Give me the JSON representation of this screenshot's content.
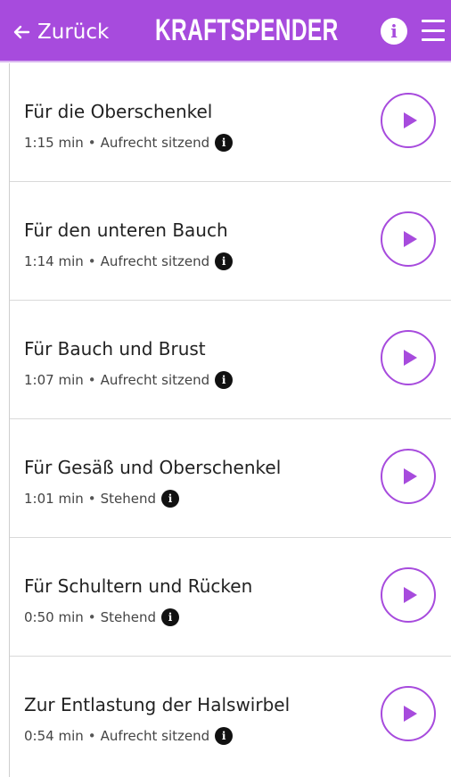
{
  "header": {
    "back_label": "Zurück",
    "title": "KRAFTSPENDER",
    "info_icon": "i",
    "menu_icon": "hamburger-menu-icon",
    "background_color": "#a74bdd"
  },
  "exercises": [
    {
      "title": "Für die Oberschenkel",
      "duration": "1:15 min",
      "position": "Aufrecht sitzend"
    },
    {
      "title": "Für den unteren Bauch",
      "duration": "1:14 min",
      "position": "Aufrecht sitzend"
    },
    {
      "title": "Für Bauch und Brust",
      "duration": "1:07 min",
      "position": "Aufrecht sitzend"
    },
    {
      "title": "Für Gesäß und Oberschenkel",
      "duration": "1:01 min",
      "position": "Stehend"
    },
    {
      "title": "Für Schultern und Rücken",
      "duration": "0:50 min",
      "position": "Stehend"
    },
    {
      "title": "Zur Entlastung der Halswirbel",
      "duration": "0:54 min",
      "position": "Aufrecht sitzend"
    }
  ],
  "meta_separator": "•",
  "item_info_icon": "i",
  "colors": {
    "accent": "#a74bdd",
    "text": "#222222",
    "divider": "#d9d9d9"
  }
}
